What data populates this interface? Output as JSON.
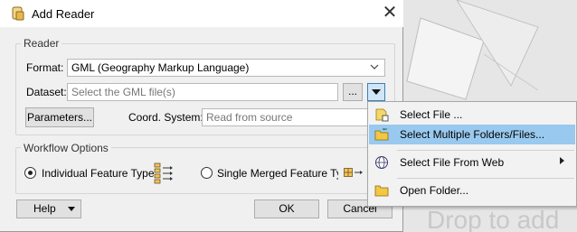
{
  "dialog": {
    "title": "Add Reader",
    "reader_group": {
      "label": "Reader",
      "format_label": "Format:",
      "format_value": "GML (Geography Markup Language)",
      "dataset_label": "Dataset:",
      "dataset_placeholder": "Select the GML file(s)",
      "browse_label": "...",
      "parameters_label": "Parameters...",
      "coord_label": "Coord. System:",
      "coord_value": "Read from source"
    },
    "workflow_group": {
      "label": "Workflow Options",
      "option1": "Individual Feature Type",
      "option2": "Single Merged Feature Type"
    },
    "buttons": {
      "help": "Help",
      "ok": "OK",
      "cancel": "Cancel"
    }
  },
  "menu": {
    "items": [
      {
        "label": "Select File ...",
        "icon": "file-icon"
      },
      {
        "label": "Select Multiple Folders/Files...",
        "icon": "multi-folder-icon"
      },
      {
        "label": "Select File From Web",
        "icon": "web-icon"
      },
      {
        "label": "Open Folder...",
        "icon": "folder-icon"
      }
    ]
  },
  "background": {
    "watermark": "Drop to add"
  },
  "colors": {
    "menu_highlight": "#99c9ef",
    "dialog_bg": "#f0f0f0"
  }
}
